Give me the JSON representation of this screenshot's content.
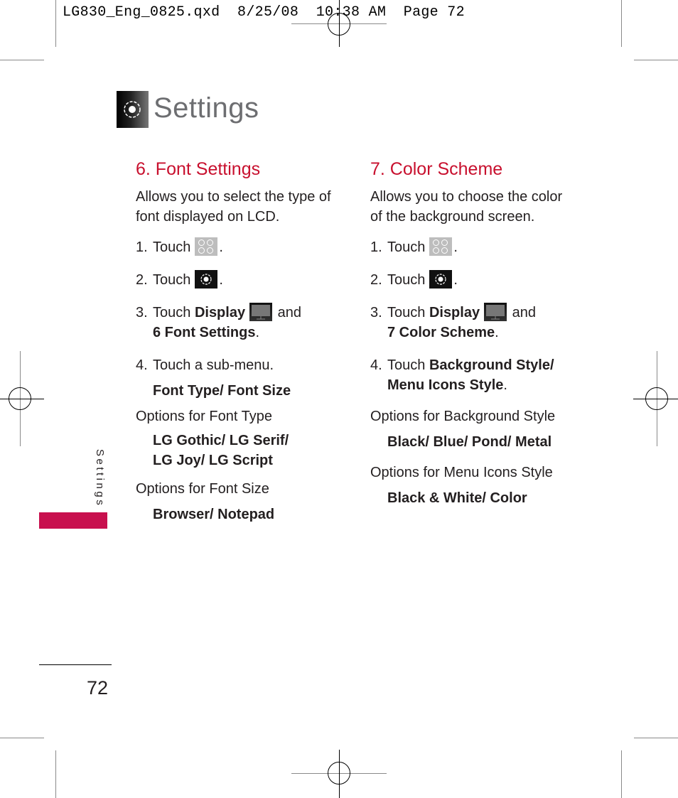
{
  "slug": "LG830_Eng_0825.qxd  8/25/08  10:38 AM  Page 72",
  "header": {
    "title": "Settings",
    "icon": "settings-gear-icon"
  },
  "colors": {
    "accent": "#c8102e",
    "tab": "#c8104e",
    "title_gray": "#6d6e71",
    "text": "#231f20"
  },
  "sections": [
    {
      "heading": "6. Font Settings",
      "intro": "Allows you to select the type of font displayed on LCD.",
      "steps": [
        {
          "num": "1.",
          "text": "Touch",
          "icon": "apps-grid-icon",
          "after": "."
        },
        {
          "num": "2.",
          "text": "Touch",
          "icon": "settings-gear-icon",
          "after": "."
        },
        {
          "num": "3.",
          "text": "Touch",
          "bold": "Display",
          "icon": "display-monitor-icon",
          "and": "and",
          "bold2": "6 Font Settings",
          "after": "."
        },
        {
          "num": "4.",
          "text": "Touch a sub-menu."
        }
      ],
      "submenu": "Font Type/ Font Size",
      "options": [
        {
          "label": "Options for Font Type",
          "lines": [
            "LG Gothic/ LG Serif/",
            "LG Joy/ LG Script"
          ]
        },
        {
          "label": "Options for Font Size",
          "lines": [
            "Browser/ Notepad"
          ]
        }
      ]
    },
    {
      "heading": "7. Color Scheme",
      "intro": "Allows you to choose the color of the background screen.",
      "steps": [
        {
          "num": "1.",
          "text": "Touch",
          "icon": "apps-grid-icon",
          "after": "."
        },
        {
          "num": "2.",
          "text": "Touch",
          "icon": "settings-gear-icon",
          "after": "."
        },
        {
          "num": "3.",
          "text": "Touch",
          "bold": "Display",
          "icon": "display-monitor-icon",
          "and": "and",
          "bold2": "7 Color Scheme",
          "after": "."
        },
        {
          "num": "4.",
          "text": "Touch",
          "bold": "Background Style/",
          "bold2": "Menu Icons Style",
          "after": "."
        }
      ],
      "options": [
        {
          "label": "Options for Background Style",
          "lines": [
            "Black/ Blue/ Pond/ Metal"
          ]
        },
        {
          "label": "Options for Menu Icons Style",
          "lines": [
            "Black & White/ Color"
          ]
        }
      ]
    }
  ],
  "side_tab": "Settings",
  "page_number": "72"
}
